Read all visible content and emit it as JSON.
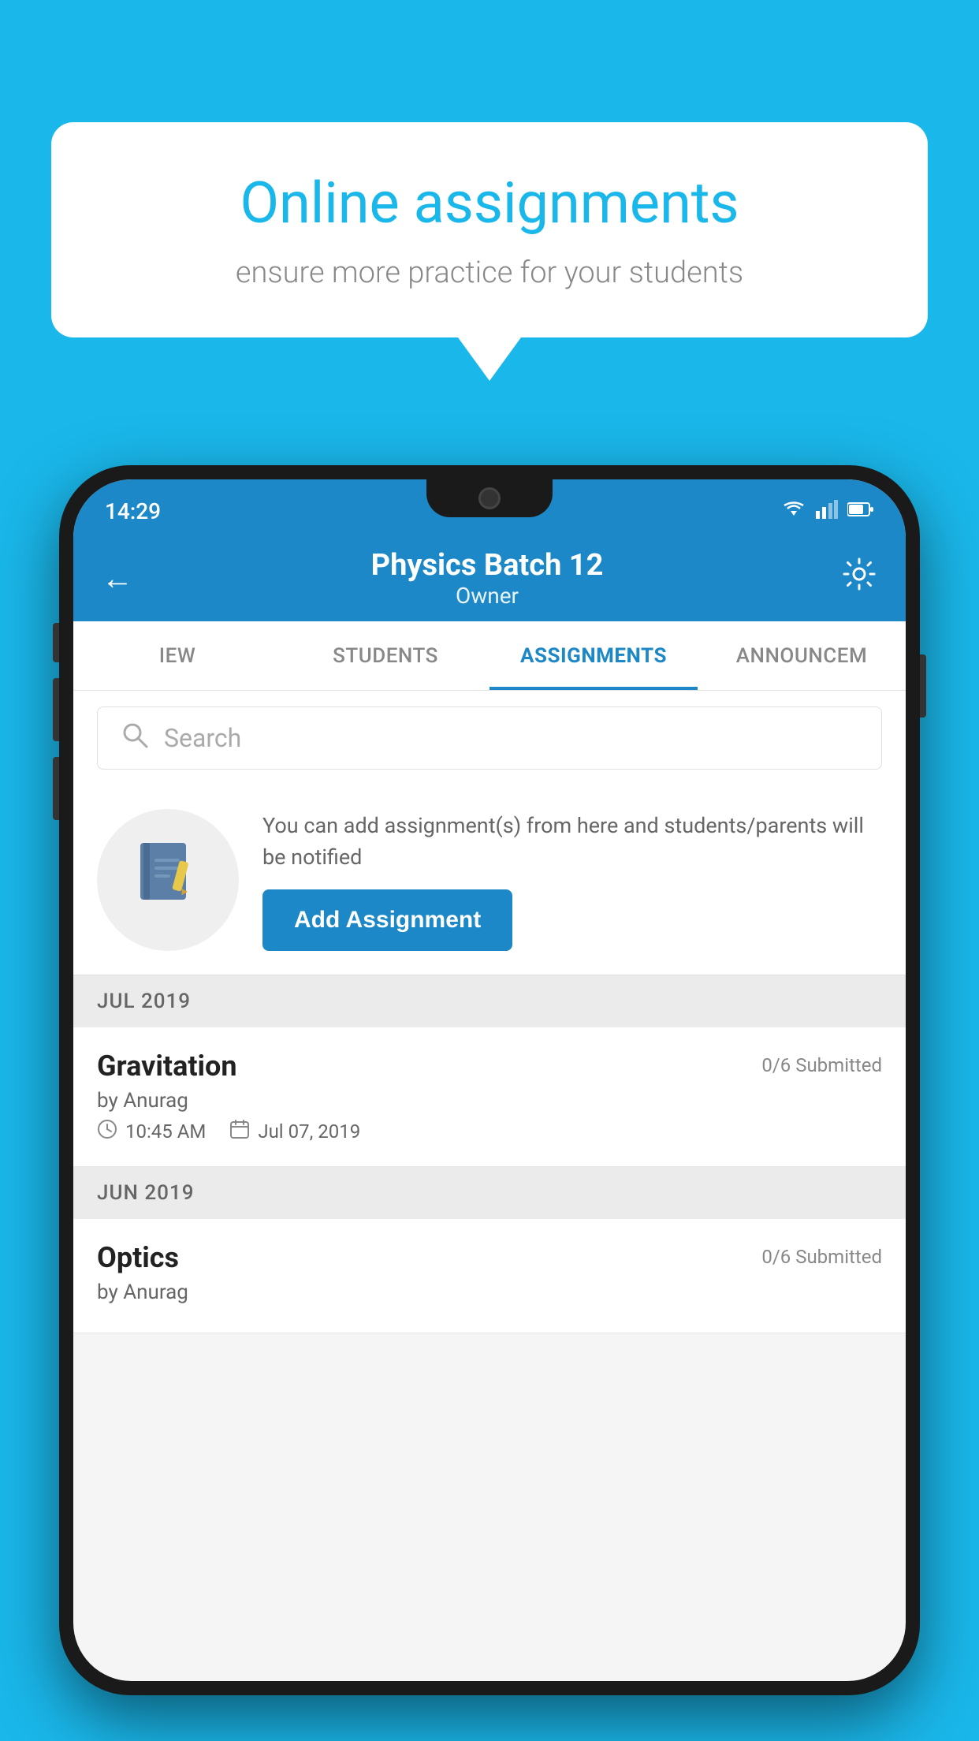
{
  "background_color": "#1ab7ea",
  "speech_bubble": {
    "title": "Online assignments",
    "subtitle": "ensure more practice for your students"
  },
  "status_bar": {
    "time": "14:29",
    "wifi": "▼▲",
    "signal": "▲",
    "battery": "▉"
  },
  "header": {
    "title": "Physics Batch 12",
    "subtitle": "Owner",
    "back_label": "←",
    "settings_label": "⚙"
  },
  "tabs": [
    {
      "label": "IEW",
      "active": false
    },
    {
      "label": "STUDENTS",
      "active": false
    },
    {
      "label": "ASSIGNMENTS",
      "active": true
    },
    {
      "label": "ANNOUNCEM",
      "active": false
    }
  ],
  "search": {
    "placeholder": "Search"
  },
  "promo": {
    "description": "You can add assignment(s) from here and students/parents will be notified",
    "button_label": "Add Assignment"
  },
  "assignment_groups": [
    {
      "month": "JUL 2019",
      "assignments": [
        {
          "name": "Gravitation",
          "submitted": "0/6 Submitted",
          "by": "by Anurag",
          "time": "10:45 AM",
          "date": "Jul 07, 2019"
        }
      ]
    },
    {
      "month": "JUN 2019",
      "assignments": [
        {
          "name": "Optics",
          "submitted": "0/6 Submitted",
          "by": "by Anurag",
          "time": "",
          "date": ""
        }
      ]
    }
  ]
}
